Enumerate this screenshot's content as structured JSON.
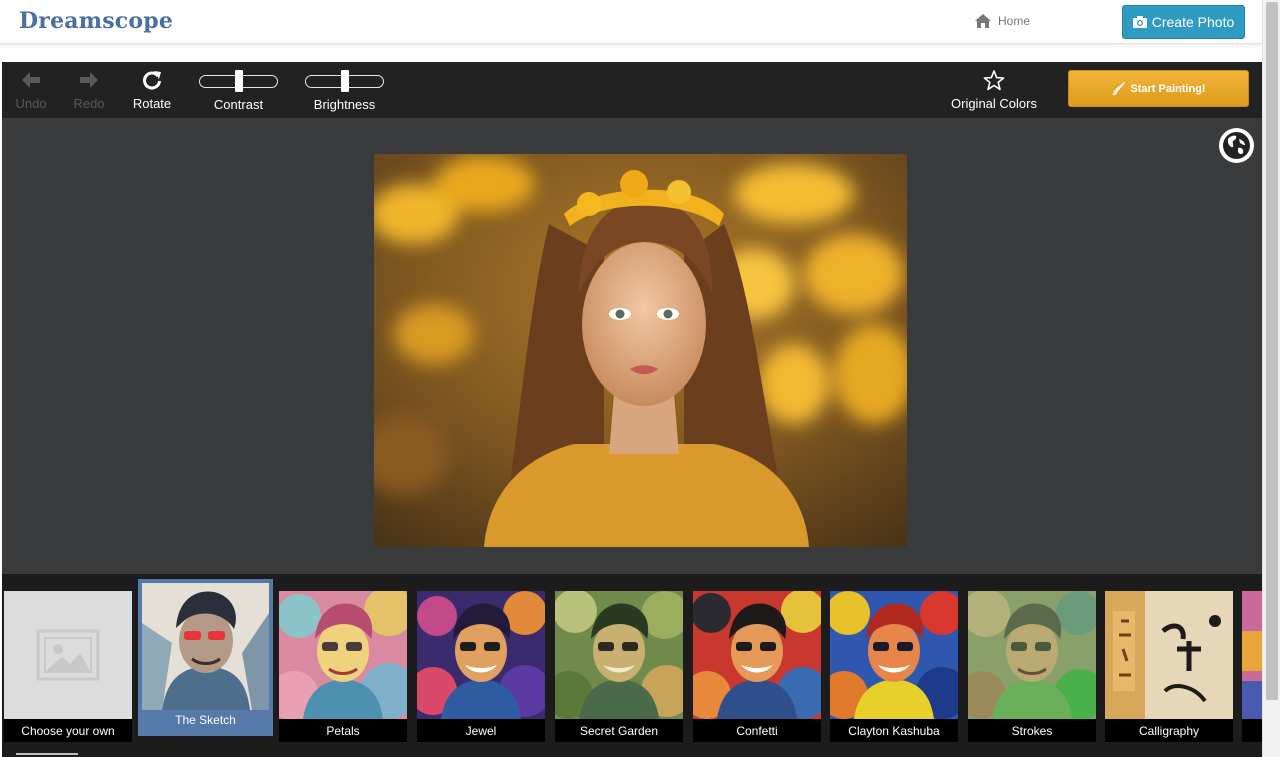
{
  "navbar": {
    "brand": "Dreamscope",
    "home_label": "Home",
    "create_label": "Create Photo"
  },
  "toolbar": {
    "undo_label": "Undo",
    "redo_label": "Redo",
    "rotate_label": "Rotate",
    "contrast_label": "Contrast",
    "contrast_value": 0.5,
    "brightness_label": "Brightness",
    "brightness_value": 0.5,
    "original_colors_label": "Original Colors",
    "start_label": "Start Painting!"
  },
  "filters": [
    {
      "name": "Choose your own",
      "selected": false
    },
    {
      "name": "The Sketch",
      "selected": true
    },
    {
      "name": "Petals",
      "selected": false
    },
    {
      "name": "Jewel",
      "selected": false
    },
    {
      "name": "Secret Garden",
      "selected": false
    },
    {
      "name": "Confetti",
      "selected": false
    },
    {
      "name": "Clayton Kashuba",
      "selected": false
    },
    {
      "name": "Strokes",
      "selected": false
    },
    {
      "name": "Calligraphy",
      "selected": false
    }
  ],
  "colors": {
    "brand": "#4a6fa5",
    "create_button": "#2f9ac2",
    "start_button": "#e8a72b",
    "selected_filter": "#5579a8",
    "toolbar": "#222222",
    "canvas": "#3a3b3d"
  },
  "icons": {
    "home": "home-icon",
    "camera": "camera-icon",
    "undo": "arrow-left-icon",
    "redo": "arrow-right-icon",
    "rotate": "rotate-icon",
    "original_colors": "star-icon",
    "start": "brush-icon",
    "globe": "globe-icon",
    "choose": "image-placeholder-icon"
  }
}
